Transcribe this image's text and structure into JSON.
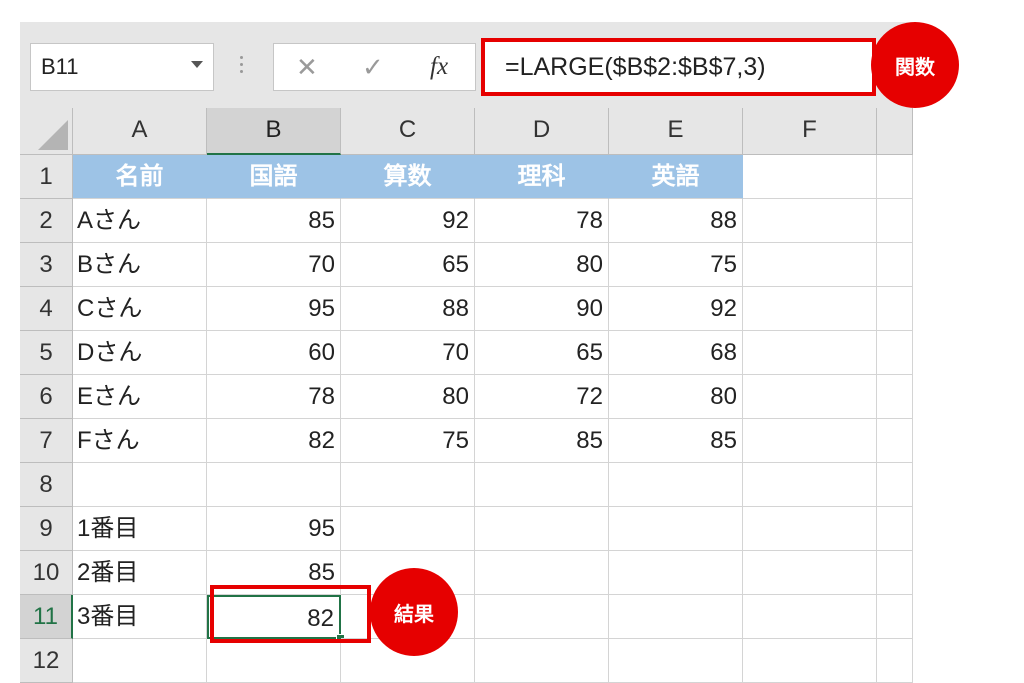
{
  "namebox": {
    "value": "B11"
  },
  "formula_bar": {
    "cancel_icon": "✕",
    "enter_icon": "✓",
    "fx_label": "fx",
    "formula": "=LARGE($B$2:$B$7,3)"
  },
  "callouts": {
    "function_label": "関数",
    "result_label": "結果"
  },
  "columns": [
    "A",
    "B",
    "C",
    "D",
    "E",
    "F"
  ],
  "rows": [
    [
      "名前",
      "国語",
      "算数",
      "理科",
      "英語",
      ""
    ],
    [
      "Aさん",
      "85",
      "92",
      "78",
      "88",
      ""
    ],
    [
      "Bさん",
      "70",
      "65",
      "80",
      "75",
      ""
    ],
    [
      "Cさん",
      "95",
      "88",
      "90",
      "92",
      ""
    ],
    [
      "Dさん",
      "60",
      "70",
      "65",
      "68",
      ""
    ],
    [
      "Eさん",
      "78",
      "80",
      "72",
      "80",
      ""
    ],
    [
      "Fさん",
      "82",
      "75",
      "85",
      "85",
      ""
    ],
    [
      "",
      "",
      "",
      "",
      "",
      ""
    ],
    [
      "1番目",
      "95",
      "",
      "",
      "",
      ""
    ],
    [
      "2番目",
      "85",
      "",
      "",
      "",
      ""
    ],
    [
      "3番目",
      "82",
      "",
      "",
      "",
      ""
    ],
    [
      "",
      "",
      "",
      "",
      "",
      ""
    ]
  ],
  "colors": {
    "accent": "#217346",
    "header_fill": "#9dc3e6",
    "highlight": "#e60000"
  },
  "selected_cell": "B11"
}
